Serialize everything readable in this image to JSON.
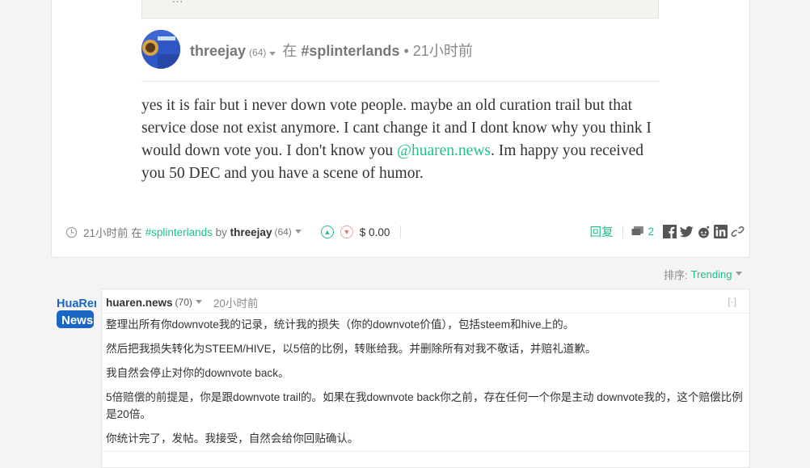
{
  "top_post": {
    "quote_excerpt": "…",
    "author": "threejay",
    "reputation": "(64)",
    "in_word": "在",
    "community_tag": "#splinterlands",
    "dot": "•",
    "time": "21小时前",
    "body_parts": {
      "text1": "yes it is fair but i never down vote people. maybe an old curation trail but that service dose not exist anymore. I cant change it and I dont know why you think I would down vote you. I don't know you ",
      "mention": "@huaren.news",
      "text2": ". Im happy you received you 50 DEC and you have a scene of humor."
    },
    "footer": {
      "time": "21小时前",
      "in_word": "在",
      "tag": "#splinterlands",
      "by_word": "by",
      "author": "threejay",
      "reputation": "(64)",
      "payout": "$ 0.00",
      "reply": "回复",
      "comment_count": "2"
    }
  },
  "sort": {
    "label": "排序:",
    "value": "Trending"
  },
  "comment": {
    "logo_text_line1": "HuaRen",
    "logo_text_line2": "News",
    "author": "huaren.news",
    "reputation": "(70)",
    "time": "20小时前",
    "collapse": "[-]",
    "paragraphs": [
      "整理出所有你downvote我的记录，统计我的损失（你的downvote价值），包括steem和hive上的。",
      "然后把我损失转化为STEEM/HIVE，以5倍的比例，转账给我。并删除所有对我不敬话，并赔礼道歉。",
      "我自然会停止对你的downvote back。",
      "5倍赔偿的前提是，你是跟downvote trail的。如果在我downvote back你之前，存在任何一个你是主动 downvote我的，这个赔偿比例是20倍。",
      "你统计完了，发帖。我接受，自然会给你回贴确认。"
    ]
  },
  "colors": {
    "accent": "#1fbf8f",
    "logo_blue": "#1a66c4"
  }
}
